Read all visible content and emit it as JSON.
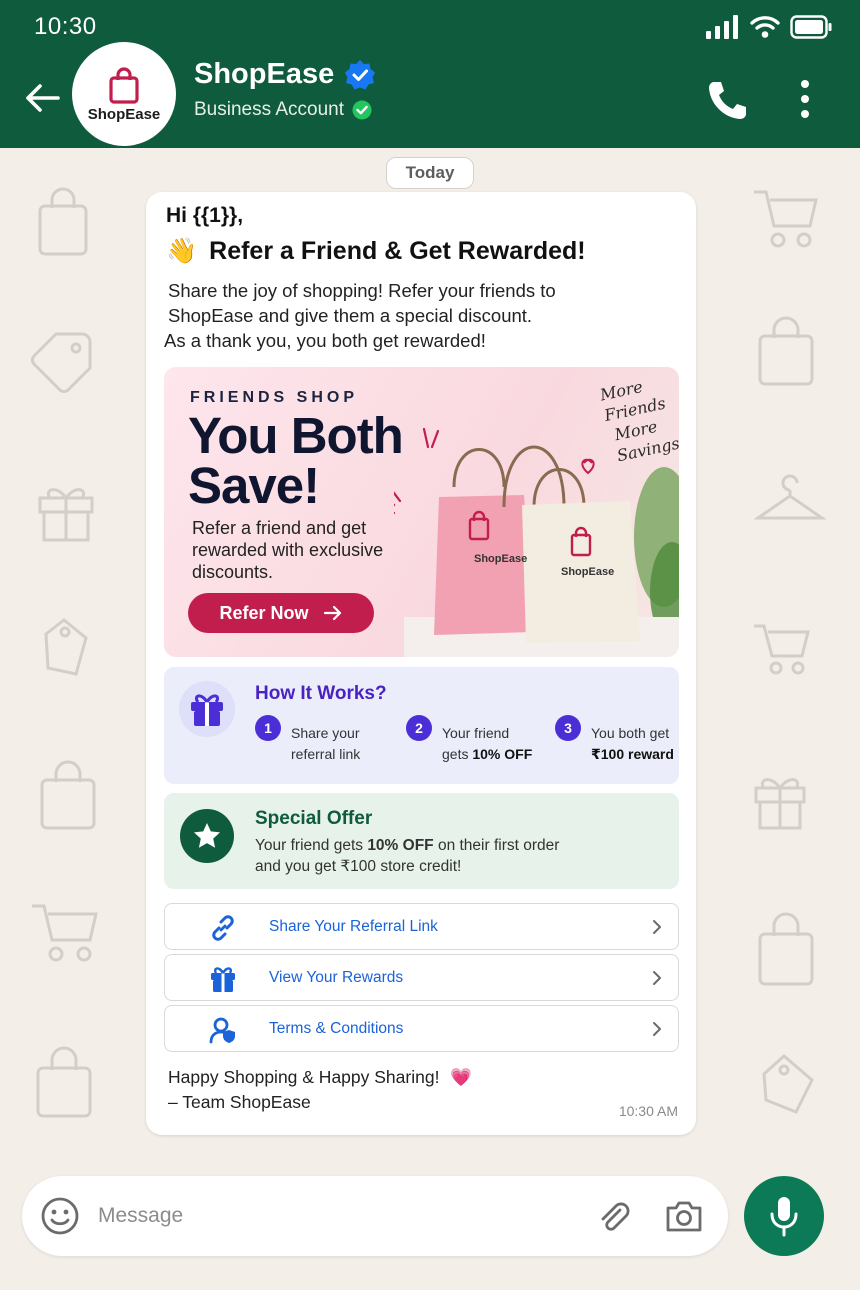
{
  "status_bar": {
    "time": "10:30"
  },
  "header": {
    "avatar_label": "ShopEase",
    "name": "ShopEase",
    "subtitle": "Business Account"
  },
  "chat": {
    "date_chip": "Today",
    "message": {
      "greeting": "Hi {{1}},",
      "headline_emoji": "👋",
      "headline": "Refer a Friend & Get Rewarded!",
      "body_line1": "Share the joy of shopping! Refer your friends to",
      "body_line2": "ShopEase and give them a special discount.",
      "body_line3": "As a thank you, you both get rewarded!",
      "banner": {
        "eyebrow": "FRIENDS SHOP",
        "title_line1": "You Both",
        "title_line2": "Save!",
        "description": "Refer a friend and get rewarded with exclusive discounts.",
        "button_label": "Refer Now",
        "handwritten_1": "More",
        "handwritten_2": "Friends",
        "handwritten_3": "More",
        "handwritten_4": "Savings",
        "bag_label_1": "ShopEase",
        "bag_label_2": "ShopEase"
      },
      "how_it_works": {
        "title": "How It Works?",
        "steps": [
          {
            "num": "1",
            "line1": "Share your",
            "line2": "referral link"
          },
          {
            "num": "2",
            "line1": "Your friend",
            "line2_prefix": "gets ",
            "line2_bold": "10% OFF"
          },
          {
            "num": "3",
            "line1": "You both get",
            "line2_bold": "₹100 reward"
          }
        ]
      },
      "special_offer": {
        "title": "Special Offer",
        "text_prefix": "Your friend gets ",
        "text_bold": "10% OFF",
        "text_suffix": " on their first order",
        "text_line2": "and you get ₹100 store credit!"
      },
      "actions": [
        {
          "label": "Share Your Referral Link",
          "icon": "link-icon"
        },
        {
          "label": "View Your Rewards",
          "icon": "gift-icon"
        },
        {
          "label": "Terms & Conditions",
          "icon": "user-shield-icon"
        }
      ],
      "signoff_line1": "Happy Shopping & Happy Sharing!",
      "signoff_emoji": "💗",
      "signoff_line2": "– Team ShopEase",
      "time": "10:30 AM"
    }
  },
  "input_bar": {
    "placeholder": "Message"
  },
  "colors": {
    "header": "#0f5b3e",
    "accent_pink": "#c11e4d",
    "step_purple": "#4b2ed6",
    "link_blue": "#1a63d8",
    "mic_green": "#0d7a57"
  }
}
